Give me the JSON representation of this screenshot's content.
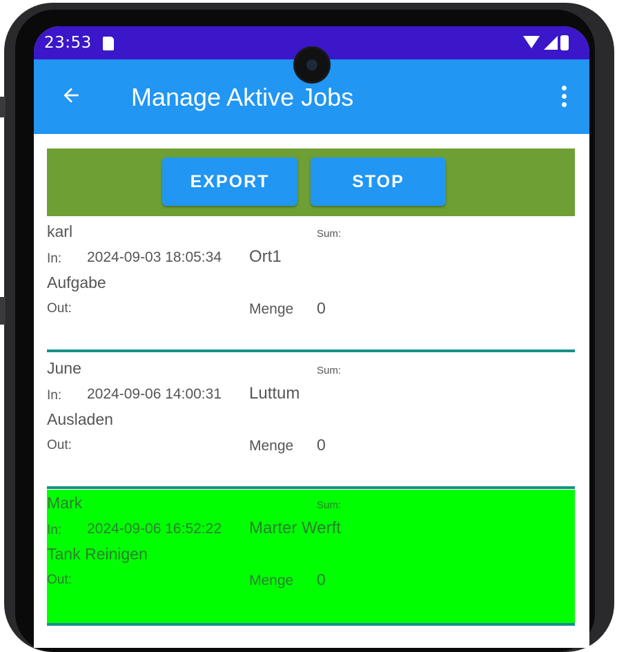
{
  "status_bar": {
    "time": "23:53",
    "sd_icon": "sd-card-icon",
    "wifi_icon": "wifi-icon",
    "signal_icon": "signal-icon",
    "battery_icon": "battery-icon",
    "background": "#3b17c9"
  },
  "app_bar": {
    "title": "Manage Aktive Jobs",
    "back_icon": "arrow-back-icon",
    "menu_icon": "more-vert-icon",
    "background": "#2196f3"
  },
  "toolbar": {
    "background": "#6e9f34",
    "export_label": "EXPORT",
    "stop_label": "STOP"
  },
  "jobs": [
    {
      "name": "karl",
      "sum_label": "Sum:",
      "in_label": "In:",
      "in_time": "2024-09-03 18:05:34",
      "ort": "Ort1",
      "task": "Aufgabe",
      "out_label": "Out:",
      "menge_label": "Menge",
      "menge": "0",
      "highlighted": false
    },
    {
      "name": "June",
      "sum_label": "Sum:",
      "in_label": "In:",
      "in_time": "2024-09-06 14:00:31",
      "ort": "Luttum",
      "task": "Ausladen",
      "out_label": "Out:",
      "menge_label": "Menge",
      "menge": "0",
      "highlighted": false
    },
    {
      "name": "Mark",
      "sum_label": "Sum:",
      "in_label": "In:",
      "in_time": "2024-09-06 16:52:22",
      "ort": "Marter Werft",
      "task": "Tank Reinigen",
      "out_label": "Out:",
      "menge_label": "Menge",
      "menge": "0",
      "highlighted": true
    }
  ],
  "colors": {
    "highlight": "#00ff00",
    "divider": "#15908a"
  }
}
